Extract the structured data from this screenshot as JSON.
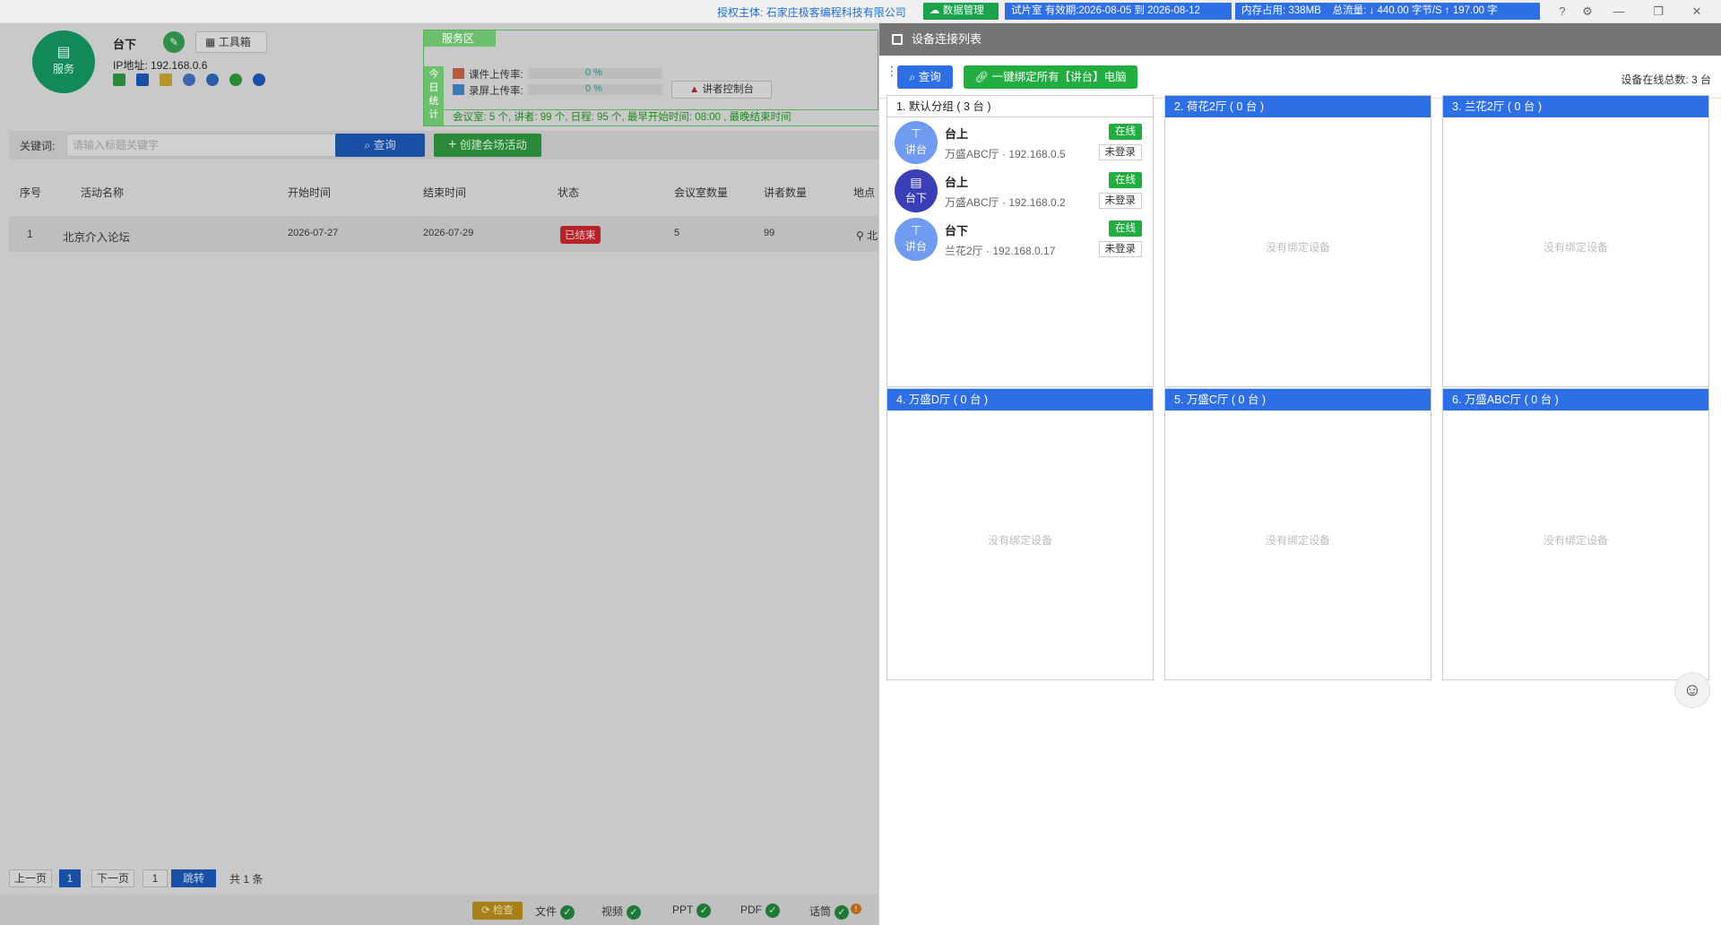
{
  "titlebar": {
    "auth_label": "授权主体:",
    "auth_company": "石家庄极客编程科技有限公司",
    "data_mgmt": "数据管理",
    "trial": "试片室 有效期:2026-08-05 到 2026-08-12",
    "memory": "内存占用:   338MB",
    "traffic": "总流量:  ↓ 440.00 字节/S    ↑ 197.00 字",
    "colors": {
      "green_pill": "#1aa34a",
      "blue_pill": "#2f6fe6",
      "auth_text": "#1e6fd9"
    }
  },
  "left": {
    "avatar_label": "服务",
    "host_name": "台下",
    "toolbox_label": "工具箱",
    "ip_label": "IP地址: 192.168.0.6",
    "service_area": {
      "tab": "服务区",
      "side_label": [
        "今",
        "日",
        "统",
        "计"
      ],
      "courseware_label": "课件上传率:",
      "courseware_value": "0 %",
      "screen_label": "录屏上传率:",
      "screen_value": "0 %",
      "console_button": "讲者控制台",
      "stats": "会议室:   5 个,    讲者:   99 个,    日程:   95 个,    最早开始时间:   08:00 ,      最晚结束时间"
    },
    "search": {
      "label": "关键词:",
      "placeholder": "请输入标题关键字",
      "query_button": "查询",
      "create_button": "创建会场活动"
    },
    "table": {
      "headers": [
        "序号",
        "活动名称",
        "开始时间",
        "结束时间",
        "状态",
        "会议室数量",
        "讲者数量",
        "地点"
      ],
      "rows": [
        {
          "index": "1",
          "name": "北京介入论坛",
          "start": "2026-07-27",
          "end": "2026-07-29",
          "status": "已结束",
          "rooms": "5",
          "speakers": "99",
          "place": "北"
        }
      ]
    },
    "pager": {
      "prev": "上一页",
      "current": "1",
      "next": "下一页",
      "input": "1",
      "jump": "跳转",
      "total": "共 1 条"
    },
    "statusbar": {
      "check": "检查",
      "items": [
        "文件",
        "视频",
        "PPT",
        "PDF",
        "话筒"
      ]
    }
  },
  "panel": {
    "title": "设备连接列表",
    "query_button": "查询",
    "bind_button": "一键绑定所有【讲台】电脑",
    "online_total": "设备在线总数: 3 台",
    "empty_text": "没有绑定设备",
    "groups": [
      {
        "title": "1.  默认分组  ( 3 台 )"
      },
      {
        "title": "2.  荷花2厅  ( 0 台 )"
      },
      {
        "title": "3.  兰花2厅  ( 0 台 )"
      },
      {
        "title": "4.  万盛D厅  ( 0 台 )"
      },
      {
        "title": "5.  万盛C厅  ( 0 台 )"
      },
      {
        "title": "6.  万盛ABC厅  ( 0 台 )"
      }
    ],
    "devices": [
      {
        "icon_label": "讲台",
        "name": "台上",
        "sub": "万盛ABC厅 · 192.168.0.5",
        "online": "在线",
        "login": "未登录",
        "icon_color": "#6f9bf0"
      },
      {
        "icon_label": "台下",
        "name": "台上",
        "sub": "万盛ABC厅 · 192.168.0.2",
        "online": "在线",
        "login": "未登录",
        "icon_color": "#3a3fb8"
      },
      {
        "icon_label": "讲台",
        "name": "台下",
        "sub": "兰花2厅 · 192.168.0.17",
        "online": "在线",
        "login": "未登录",
        "icon_color": "#6f9bf0"
      }
    ]
  }
}
